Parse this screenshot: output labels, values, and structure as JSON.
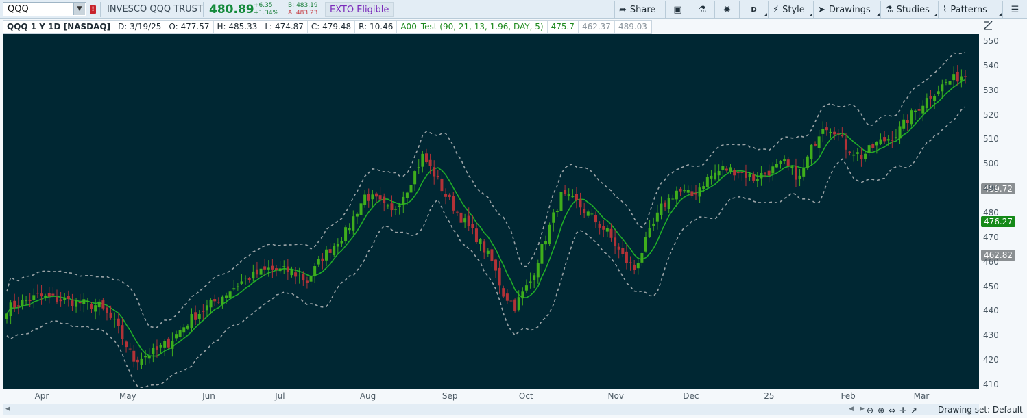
{
  "toolbar": {
    "symbol": "QQQ",
    "alert_badge": "!",
    "company": "INVESCO QQQ TRUST",
    "last_price": "480.89",
    "change": "+6.35",
    "change_pct": "+1.34%",
    "bid": "B: 483.19",
    "ask": "A: 483.23",
    "exto": "EXTO Eligible",
    "share": "Share",
    "style": "Style",
    "drawings": "Drawings",
    "studies": "Studies",
    "patterns": "Patterns",
    "timeframe_letter": "D"
  },
  "infobar": {
    "symbol": "QQQ 1 Y 1D [NASDAQ]",
    "date": "D: 3/19/25",
    "open": "O: 477.57",
    "high": "H: 485.33",
    "low": "L: 474.87",
    "close": "C: 479.48",
    "range": "R: 10.46",
    "study": "A00_Test (90, 21, 13, 1.96, DAY, 5)",
    "study_mid": "475.7",
    "study_lower": "462.37",
    "study_upper": "489.03"
  },
  "price_labels": {
    "upper": "489.72",
    "mid": "476.27",
    "lower": "462.82"
  },
  "colors": {
    "background": "#002733",
    "up_candle": "#3fae1c",
    "down_candle": "#b23237",
    "mid_line": "#1fae28",
    "band_line": "#9aa3a6",
    "mid_label": "#158a18",
    "band_label": "#8a8f92"
  },
  "status": {
    "drawing_set": "Drawing set: Default"
  },
  "icons": [
    "share-icon",
    "monitor-icon",
    "flask-icon",
    "gear-icon",
    "style-icon",
    "cursor-icon",
    "studies-flask-icon",
    "patterns-icon",
    "menu-icon",
    "drawing-tool-icon",
    "zoom-out-icon",
    "zoom-in-icon",
    "pan-horizontal-icon",
    "crosshair-icon",
    "pointer-icon"
  ],
  "chart_data": {
    "type": "candlestick",
    "ylim": [
      410,
      555
    ],
    "y_ticks": [
      410,
      420,
      430,
      440,
      450,
      460,
      470,
      480,
      490,
      500,
      510,
      520,
      530,
      540,
      550
    ],
    "x_ticks": [
      {
        "label": "Apr",
        "x": 0.04
      },
      {
        "label": "May",
        "x": 0.128
      },
      {
        "label": "Jun",
        "x": 0.211
      },
      {
        "label": "Jul",
        "x": 0.284
      },
      {
        "label": "Aug",
        "x": 0.374
      },
      {
        "label": "Sep",
        "x": 0.458
      },
      {
        "label": "Oct",
        "x": 0.536
      },
      {
        "label": "Nov",
        "x": 0.628
      },
      {
        "label": "Dec",
        "x": 0.705
      },
      {
        "label": "25",
        "x": 0.785
      },
      {
        "label": "Feb",
        "x": 0.866
      },
      {
        "label": "Mar",
        "x": 0.941
      }
    ],
    "bars": 250,
    "anchors": [
      [
        0,
        441
      ],
      [
        8,
        446
      ],
      [
        16,
        444
      ],
      [
        24,
        442
      ],
      [
        28,
        435
      ],
      [
        33,
        420
      ],
      [
        38,
        423
      ],
      [
        42,
        427
      ],
      [
        48,
        437
      ],
      [
        55,
        445
      ],
      [
        62,
        453
      ],
      [
        68,
        457
      ],
      [
        74,
        456
      ],
      [
        78,
        452
      ],
      [
        82,
        462
      ],
      [
        88,
        472
      ],
      [
        93,
        487
      ],
      [
        96,
        485
      ],
      [
        100,
        480
      ],
      [
        104,
        490
      ],
      [
        108,
        503
      ],
      [
        111,
        496
      ],
      [
        114,
        487
      ],
      [
        118,
        478
      ],
      [
        122,
        470
      ],
      [
        126,
        460
      ],
      [
        129,
        447
      ],
      [
        132,
        442
      ],
      [
        136,
        452
      ],
      [
        140,
        470
      ],
      [
        144,
        487
      ],
      [
        148,
        484
      ],
      [
        152,
        478
      ],
      [
        156,
        472
      ],
      [
        160,
        462
      ],
      [
        163,
        457
      ],
      [
        166,
        468
      ],
      [
        170,
        482
      ],
      [
        174,
        489
      ],
      [
        178,
        487
      ],
      [
        182,
        494
      ],
      [
        186,
        498
      ],
      [
        190,
        497
      ],
      [
        194,
        494
      ],
      [
        198,
        497
      ],
      [
        202,
        500
      ],
      [
        206,
        494
      ],
      [
        209,
        506
      ],
      [
        212,
        516
      ],
      [
        215,
        514
      ],
      [
        218,
        507
      ],
      [
        222,
        503
      ],
      [
        226,
        508
      ],
      [
        231,
        512
      ],
      [
        235,
        520
      ],
      [
        240,
        528
      ],
      [
        244,
        533
      ],
      [
        248,
        536
      ]
    ],
    "series": [
      {
        "name": "475.7"
      },
      {
        "name": "462.37"
      },
      {
        "name": "489.03"
      }
    ]
  }
}
